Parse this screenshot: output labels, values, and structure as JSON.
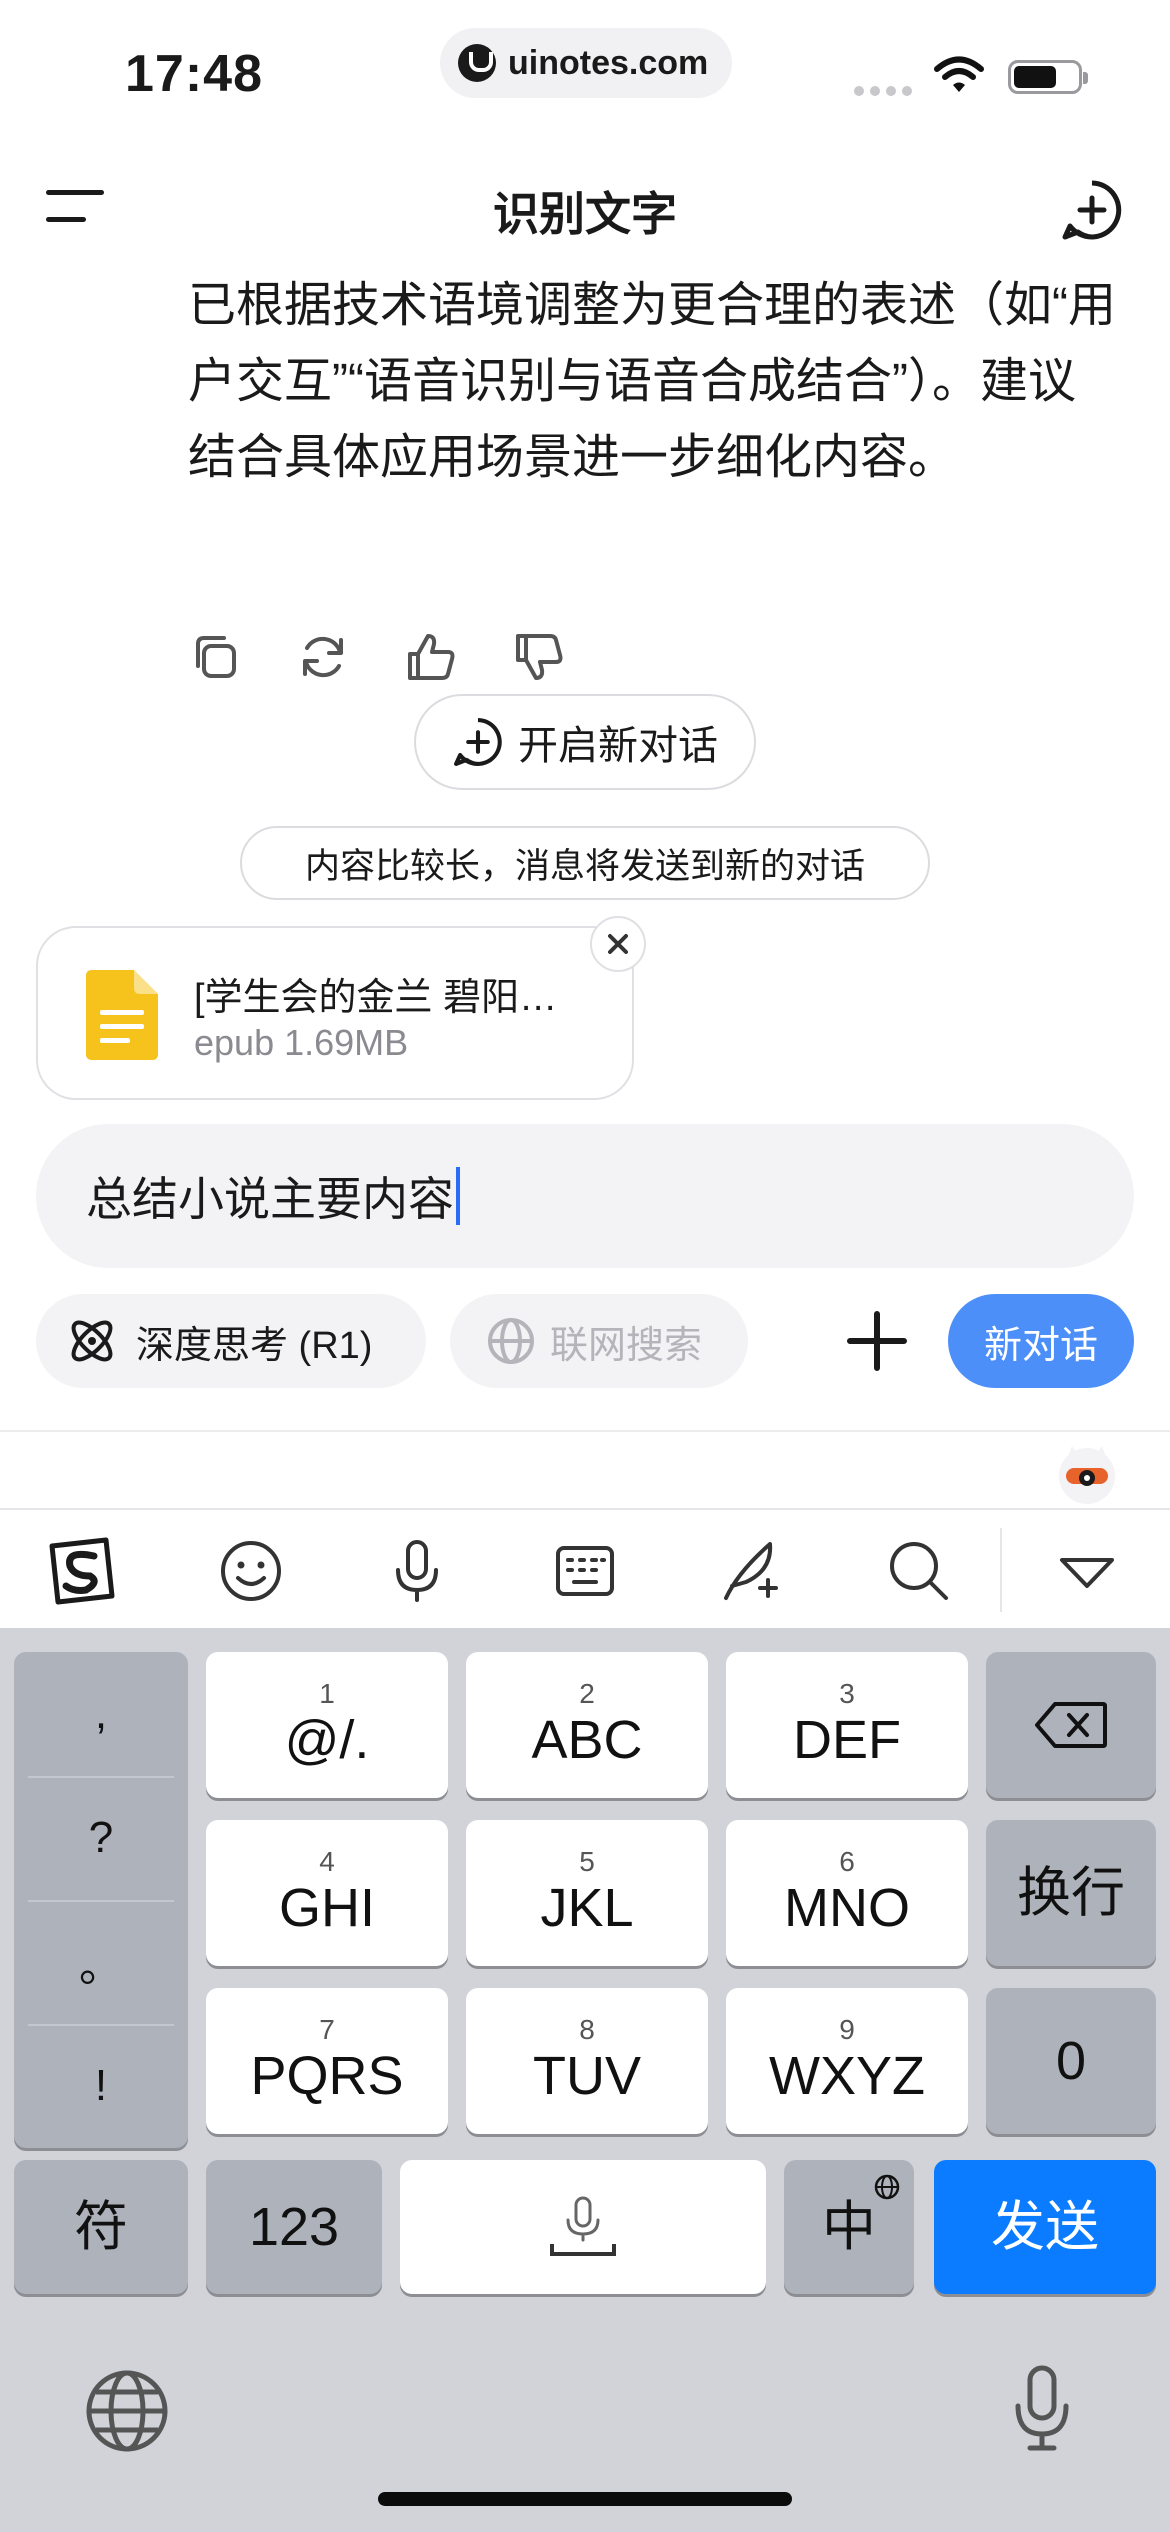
{
  "status_bar": {
    "time": "17:48",
    "url": "uinotes.com"
  },
  "header": {
    "title": "识别文字"
  },
  "message": {
    "text": "已根据技术语境调整为更合理的表述（如“用户交互”“语音识别与语音合成结合”）。建议结合具体应用场景进一步细化内容。",
    "actions": [
      "copy-icon",
      "refresh-icon",
      "thumbs-up-icon",
      "thumbs-down-icon"
    ]
  },
  "new_chat_button": {
    "label": "开启新对话"
  },
  "notice": {
    "text": "内容比较长，消息将发送到新的对话"
  },
  "attachment": {
    "name": "[学生会的金兰 碧阳…",
    "meta": "epub 1.69MB",
    "icon_color": "#f6c21c"
  },
  "input": {
    "value": "总结小说主要内容"
  },
  "toolbar": {
    "deep_think_label": "深度思考 (R1)",
    "web_search_label": "联网搜索",
    "send_label": "新对话",
    "accent": "#4d8ff8"
  },
  "keyboard": {
    "punctuation": [
      ",",
      "?",
      "。",
      "!"
    ],
    "keys": [
      {
        "num": "1",
        "label": "@/."
      },
      {
        "num": "2",
        "label": "ABC"
      },
      {
        "num": "3",
        "label": "DEF"
      },
      {
        "num": "4",
        "label": "GHI"
      },
      {
        "num": "5",
        "label": "JKL"
      },
      {
        "num": "6",
        "label": "MNO"
      },
      {
        "num": "7",
        "label": "PQRS"
      },
      {
        "num": "8",
        "label": "TUV"
      },
      {
        "num": "9",
        "label": "WXYZ"
      }
    ],
    "return_label": "换行",
    "zero_label": "0",
    "symbol_label": "符",
    "numeric_label": "123",
    "lang_label": "中",
    "send_label": "发送",
    "send_color": "#0b7cff"
  }
}
